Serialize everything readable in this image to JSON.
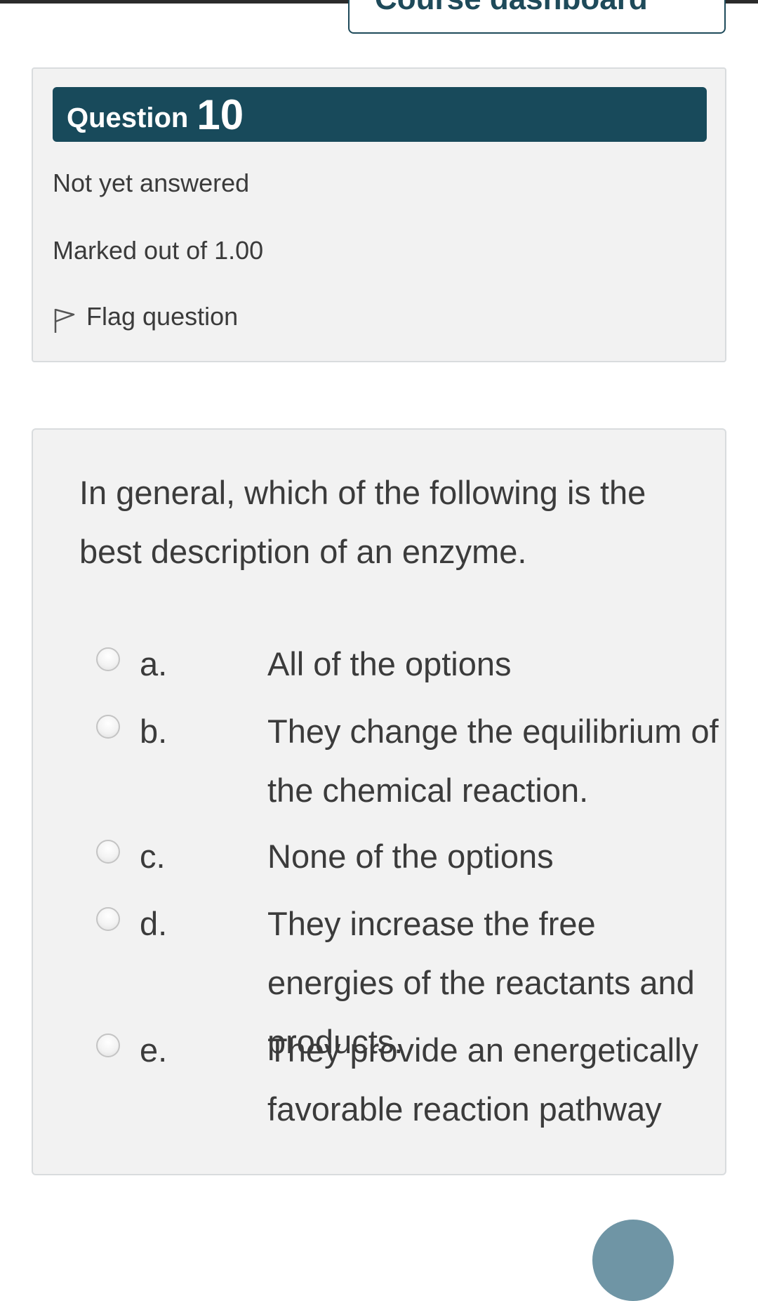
{
  "header": {
    "dashboard_button_label": "Course dashboard"
  },
  "question_info": {
    "question_word": "Question",
    "question_number": "10",
    "state": "Not yet answered",
    "grade": "Marked out of 1.00",
    "flag_label": "Flag question"
  },
  "question": {
    "text": "In general, which of the following is the best description of an enzyme.",
    "answers": [
      {
        "letter": "a.",
        "text": "All of the options"
      },
      {
        "letter": "b.",
        "text": "They change the equilibrium of the chemical reaction."
      },
      {
        "letter": "c.",
        "text": "None of the options"
      },
      {
        "letter": "d.",
        "text": "They increase the free energies of the reactants and products."
      },
      {
        "letter": "e.",
        "text": "They provide an energetically favorable reaction pathway"
      }
    ]
  },
  "colors": {
    "banner": "#184a5b",
    "card_background": "#f2f2f2",
    "text": "#3b3b3b"
  }
}
